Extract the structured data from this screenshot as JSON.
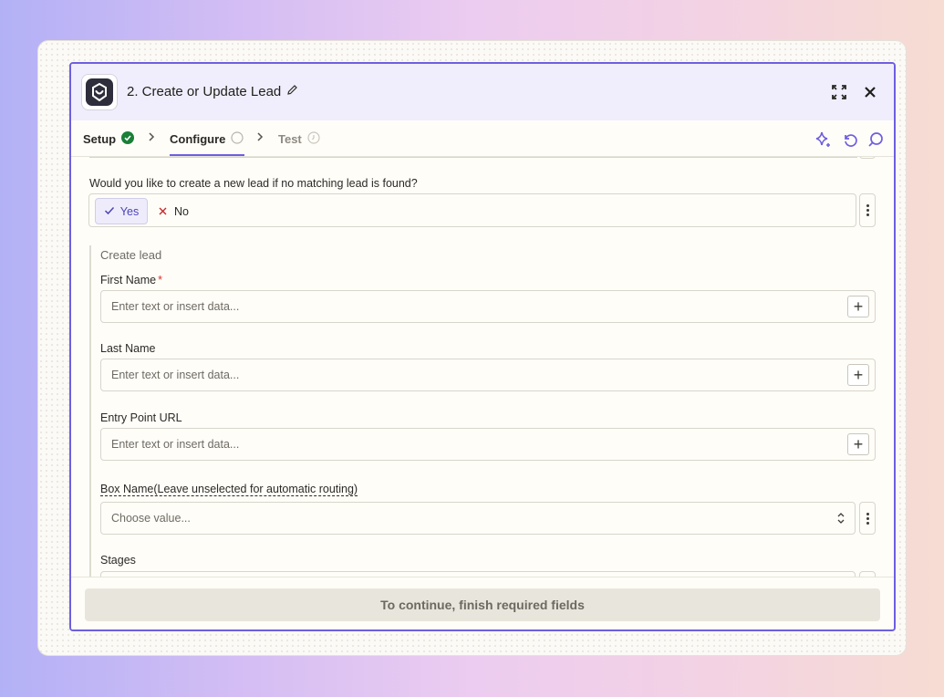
{
  "header": {
    "title": "2. Create or Update Lead",
    "icons": [
      "app-logo-icon",
      "pencil-icon",
      "expand-icon",
      "close-icon"
    ]
  },
  "tabs": [
    {
      "label": "Setup",
      "status": "complete"
    },
    {
      "label": "Configure",
      "status": "active"
    },
    {
      "label": "Test",
      "status": "pending"
    }
  ],
  "toolbar_icons": [
    "sparkle-icon",
    "undo-icon",
    "search-icon"
  ],
  "question": {
    "label": "Would you like to create a new lead if no matching lead is found?",
    "options": [
      "Yes",
      "No"
    ],
    "selected": "Yes"
  },
  "group": {
    "label": "Create lead",
    "fields": [
      {
        "label": "First Name",
        "required": "*",
        "placeholder": "Enter text or insert data..."
      },
      {
        "label": "Last Name",
        "placeholder": "Enter text or insert data..."
      },
      {
        "label": "Entry Point URL",
        "placeholder": "Enter text or insert data..."
      },
      {
        "label": "Box Name(Leave unselected for automatic routing)",
        "placeholder": "Choose value..."
      },
      {
        "label": "Stages"
      }
    ]
  },
  "footer": {
    "button_label": "To continue, finish required fields"
  },
  "colors": {
    "accent": "#6d5fe0",
    "success": "#1a7f37",
    "required": "#d9352c",
    "no_x": "#c62828"
  }
}
